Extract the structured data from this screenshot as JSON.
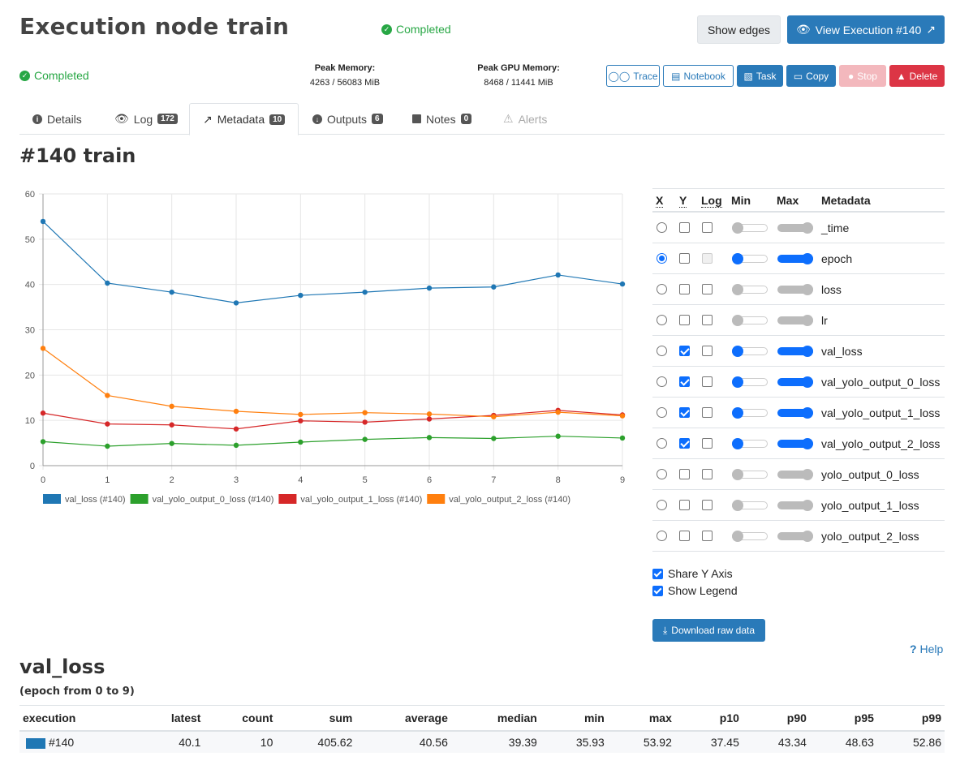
{
  "header": {
    "title": "Execution node train",
    "status": "Completed",
    "show_edges": "Show edges",
    "view_execution": "View Execution #140"
  },
  "summary": {
    "status": "Completed",
    "peak_memory_label": "Peak Memory:",
    "peak_memory_value": "4263 / 56083 MiB",
    "peak_gpu_label": "Peak GPU Memory:",
    "peak_gpu_value": "8468 / 11441 MiB"
  },
  "actions": {
    "trace": "Trace",
    "notebook": "Notebook",
    "task": "Task",
    "copy": "Copy",
    "stop": "Stop",
    "delete": "Delete"
  },
  "tabs": [
    {
      "label": "Details",
      "badge": ""
    },
    {
      "label": "Log",
      "badge": "172"
    },
    {
      "label": "Metadata",
      "badge": "10"
    },
    {
      "label": "Outputs",
      "badge": "6"
    },
    {
      "label": "Notes",
      "badge": "0"
    },
    {
      "label": "Alerts",
      "badge": ""
    }
  ],
  "section_title": "#140 train",
  "meta_table": {
    "headers": {
      "x": "X",
      "y": "Y",
      "log": "Log",
      "min": "Min",
      "max": "Max",
      "metadata": "Metadata"
    },
    "rows": [
      {
        "name": "_time",
        "x": false,
        "y": false,
        "log_disabled": false,
        "active": false
      },
      {
        "name": "epoch",
        "x": true,
        "y": false,
        "log_disabled": true,
        "active": true
      },
      {
        "name": "loss",
        "x": false,
        "y": false,
        "log_disabled": false,
        "active": false
      },
      {
        "name": "lr",
        "x": false,
        "y": false,
        "log_disabled": false,
        "active": false
      },
      {
        "name": "val_loss",
        "x": false,
        "y": true,
        "log_disabled": false,
        "active": true
      },
      {
        "name": "val_yolo_output_0_loss",
        "x": false,
        "y": true,
        "log_disabled": false,
        "active": true
      },
      {
        "name": "val_yolo_output_1_loss",
        "x": false,
        "y": true,
        "log_disabled": false,
        "active": true
      },
      {
        "name": "val_yolo_output_2_loss",
        "x": false,
        "y": true,
        "log_disabled": false,
        "active": true
      },
      {
        "name": "yolo_output_0_loss",
        "x": false,
        "y": false,
        "log_disabled": false,
        "active": false
      },
      {
        "name": "yolo_output_1_loss",
        "x": false,
        "y": false,
        "log_disabled": false,
        "active": false
      },
      {
        "name": "yolo_output_2_loss",
        "x": false,
        "y": false,
        "log_disabled": false,
        "active": false
      }
    ]
  },
  "options": {
    "share_y": "Share Y Axis",
    "show_legend": "Show Legend",
    "download": "Download raw data",
    "help": "Help"
  },
  "chart_data": {
    "type": "line",
    "x": [
      0,
      1,
      2,
      3,
      4,
      5,
      6,
      7,
      8,
      9
    ],
    "xlim": [
      0,
      9
    ],
    "ylim": [
      0,
      60
    ],
    "x_ticks": [
      0,
      1,
      2,
      3,
      4,
      5,
      6,
      7,
      8,
      9
    ],
    "y_ticks": [
      0,
      10,
      20,
      30,
      40,
      50,
      60
    ],
    "grid": true,
    "legend_position": "bottom",
    "series": [
      {
        "name": "val_loss (#140)",
        "color": "#1f77b4",
        "values": [
          53.92,
          40.3,
          38.3,
          35.93,
          37.6,
          38.3,
          39.2,
          39.45,
          42.1,
          40.1
        ]
      },
      {
        "name": "val_yolo_output_0_loss (#140)",
        "color": "#2ca02c",
        "values": [
          5.3,
          4.3,
          4.9,
          4.5,
          5.2,
          5.8,
          6.2,
          6.0,
          6.5,
          6.1
        ]
      },
      {
        "name": "val_yolo_output_1_loss (#140)",
        "color": "#d62728",
        "values": [
          11.6,
          9.2,
          9.0,
          8.1,
          9.9,
          9.6,
          10.3,
          11.1,
          12.2,
          11.2
        ]
      },
      {
        "name": "val_yolo_output_2_loss (#140)",
        "color": "#ff7f0e",
        "values": [
          25.9,
          15.5,
          13.1,
          12.0,
          11.3,
          11.7,
          11.4,
          10.8,
          11.8,
          11.0
        ]
      }
    ]
  },
  "stats": {
    "title": "val_loss",
    "subtitle": "(epoch from 0 to 9)",
    "headers": [
      "execution",
      "latest",
      "count",
      "sum",
      "average",
      "median",
      "min",
      "max",
      "p10",
      "p90",
      "p95",
      "p99"
    ],
    "row": [
      "#140",
      "40.1",
      "10",
      "405.62",
      "40.56",
      "39.39",
      "35.93",
      "53.92",
      "37.45",
      "43.34",
      "48.63",
      "52.86"
    ],
    "swatch_color": "#1f77b4"
  }
}
